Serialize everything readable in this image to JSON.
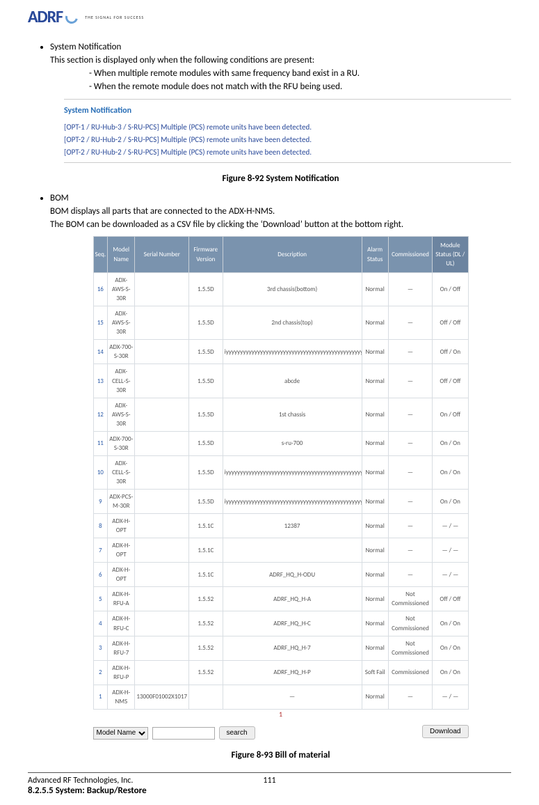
{
  "brand": {
    "name": "ADRF",
    "tagline": "THE SIGNAL FOR SUCCESS"
  },
  "section1": {
    "title": "System Notification",
    "intro": "This section is displayed only when the following conditions are present:",
    "bullets": [
      "When multiple remote modules with same frequency band exist in a RU.",
      "When the remote module does not match with the RFU being used."
    ],
    "panel_title": "System Notification",
    "panel_lines": [
      "[OPT-1 / RU-Hub-3 / S-RU-PCS] Multiple (PCS) remote units have been detected.",
      "[OPT-2 / RU-Hub-2 / S-RU-PCS] Multiple (PCS) remote units have been detected.",
      "[OPT-2 / RU-Hub-2 / S-RU-PCS] Multiple (PCS) remote units have been detected."
    ],
    "figure": "Figure 8-92    System Notification"
  },
  "section2": {
    "title": "BOM",
    "l1": "BOM displays all parts that are connected to the ADX-H-NMS.",
    "l2": "The BOM can be downloaded as a CSV file by clicking the ‘Download’ button at the bottom right.",
    "figure": "Figure 8-93    Bill of material"
  },
  "bom": {
    "headers": [
      "Seq.",
      "Model Name",
      "Serial Number",
      "Firmware Version",
      "Description",
      "Alarm Status",
      "Commissioned",
      "Module Status (DL / UL)"
    ],
    "rows": [
      {
        "seq": "16",
        "model": "ADX-AWS-S-30R",
        "serial": "",
        "fw": "1.5.5D",
        "desc": "3rd chassis(bottom)",
        "alarm": "Normal",
        "comm": "—",
        "mod": "On / Off"
      },
      {
        "seq": "15",
        "model": "ADX-AWS-S-30R",
        "serial": "",
        "fw": "1.5.5D",
        "desc": "2nd chassis(top)",
        "alarm": "Normal",
        "comm": "—",
        "mod": "Off / Off"
      },
      {
        "seq": "14",
        "model": "ADX-700-S-30R",
        "serial": "",
        "fw": "1.5.5D",
        "desc": "iyyyyyyyyyyyyyyyyyyyyyyyyyyyyyyyyyyyyyyyyyyyyyyyyyyyyy",
        "alarm": "Normal",
        "comm": "—",
        "mod": "Off / On"
      },
      {
        "seq": "13",
        "model": "ADX-CELL-S-30R",
        "serial": "",
        "fw": "1.5.5D",
        "desc": "abcde",
        "alarm": "Normal",
        "comm": "—",
        "mod": "Off / Off"
      },
      {
        "seq": "12",
        "model": "ADX-AWS-S-30R",
        "serial": "",
        "fw": "1.5.5D",
        "desc": "1st chassis",
        "alarm": "Normal",
        "comm": "—",
        "mod": "On / Off"
      },
      {
        "seq": "11",
        "model": "ADX-700-S-30R",
        "serial": "",
        "fw": "1.5.5D",
        "desc": "s-ru-700",
        "alarm": "Normal",
        "comm": "—",
        "mod": "On / On"
      },
      {
        "seq": "10",
        "model": "ADX-CELL-S-30R",
        "serial": "",
        "fw": "1.5.5D",
        "desc": "iyyyyyyyyyyyyyyyyyyyyyyyyyyyyyyyyyyyyyyyyyyyyyyyyyyyy",
        "alarm": "Normal",
        "comm": "—",
        "mod": "On / On"
      },
      {
        "seq": "9",
        "model": "ADX-PCS-M-30R",
        "serial": "",
        "fw": "1.5.5D",
        "desc": "iyyyyyyyyyyyyyyyyyyyyyyyyyyyyyyyyyyyyyyyyyyyyyyyyyyyy",
        "alarm": "Normal",
        "comm": "—",
        "mod": "On / On"
      },
      {
        "seq": "8",
        "model": "ADX-H-OPT",
        "serial": "",
        "fw": "1.5.1C",
        "desc": "12387",
        "alarm": "Normal",
        "comm": "—",
        "mod": "— / —"
      },
      {
        "seq": "7",
        "model": "ADX-H-OPT",
        "serial": "",
        "fw": "1.5.1C",
        "desc": "",
        "alarm": "Normal",
        "comm": "—",
        "mod": "— / —"
      },
      {
        "seq": "6",
        "model": "ADX-H-OPT",
        "serial": "",
        "fw": "1.5.1C",
        "desc": "ADRF_HQ_H-ODU",
        "alarm": "Normal",
        "comm": "—",
        "mod": "— / —"
      },
      {
        "seq": "5",
        "model": "ADX-H-RFU-A",
        "serial": "",
        "fw": "1.5.52",
        "desc": "ADRF_HQ_H-A",
        "alarm": "Normal",
        "comm": "Not Commissioned",
        "mod": "Off / Off"
      },
      {
        "seq": "4",
        "model": "ADX-H-RFU-C",
        "serial": "",
        "fw": "1.5.52",
        "desc": "ADRF_HQ_H-C",
        "alarm": "Normal",
        "comm": "Not Commissioned",
        "mod": "On / On"
      },
      {
        "seq": "3",
        "model": "ADX-H-RFU-7",
        "serial": "",
        "fw": "1.5.52",
        "desc": "ADRF_HQ_H-7",
        "alarm": "Normal",
        "comm": "Not Commissioned",
        "mod": "On / On"
      },
      {
        "seq": "2",
        "model": "ADX-H-RFU-P",
        "serial": "",
        "fw": "1.5.52",
        "desc": "ADRF_HQ_H-P",
        "alarm": "Soft Fail",
        "comm": "Commissioned",
        "mod": "On / On"
      },
      {
        "seq": "1",
        "model": "ADX-H-NMS",
        "serial": "13000F01002X1017",
        "fw": "",
        "desc": "—",
        "alarm": "Normal",
        "comm": "—",
        "mod": "— / —"
      }
    ],
    "pager": "1",
    "filter_field": "Model Name",
    "search_btn": "search",
    "download_btn": "Download"
  },
  "heading825": "8.2.5.5    System: Backup/Restore",
  "footer": {
    "left": "Advanced RF Technologies, Inc.",
    "center": "111"
  }
}
